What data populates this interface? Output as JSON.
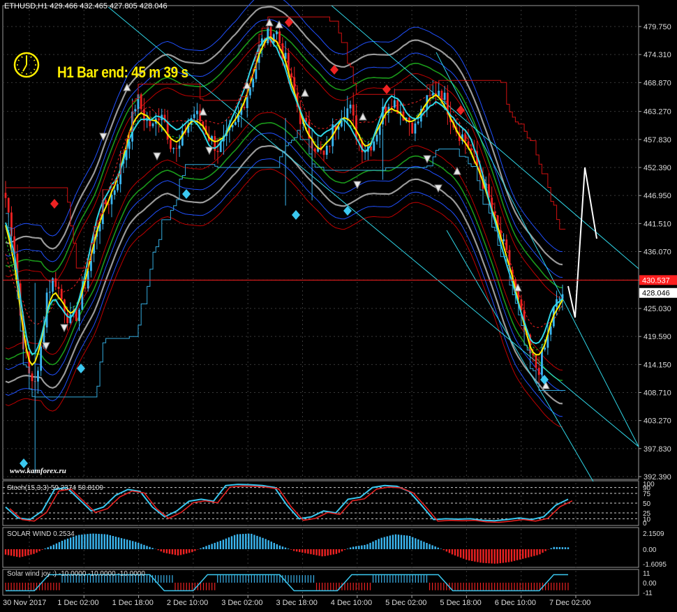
{
  "header": {
    "text": "ETHUSD,H1  429.466 432.465 427.805 428.046"
  },
  "timer": {
    "label": "H1 Bar end: 45 m 39 s"
  },
  "watermark": "www.kamforex.ru",
  "price_axis": {
    "ticks": [
      "479.750",
      "474.310",
      "468.870",
      "463.270",
      "457.830",
      "452.390",
      "446.950",
      "441.510",
      "436.070",
      "430.537",
      "425.030",
      "419.590",
      "414.150",
      "408.710",
      "403.270",
      "397.830",
      "392.390"
    ],
    "current_price": "428.046",
    "ask_line": "430.537"
  },
  "time_axis": {
    "labels": [
      "30 Nov 2017",
      "1 Dec 02:00",
      "1 Dec 18:00",
      "2 Dec 10:00",
      "3 Dec 02:00",
      "3 Dec 18:00",
      "4 Dec 10:00",
      "5 Dec 02:00",
      "5 Dec 18:00",
      "6 Dec 10:00",
      "7 Dec 02:00"
    ]
  },
  "subwindows": {
    "stoch": {
      "label": "Stoch(15,3,3) 59.2374 50.8109",
      "levels": [
        "100",
        "90",
        "75",
        "50",
        "25",
        "10",
        "0"
      ]
    },
    "solar_wind": {
      "label": "SOLAR WIND 0.2534",
      "levels": [
        "2.1509",
        "0.00",
        "-1.6095"
      ]
    },
    "solar_wind_joy": {
      "label": "Solar wind joy :) -10.0000 -10.0000 -10.0000",
      "levels": [
        "11",
        "0.00",
        "-11"
      ]
    }
  },
  "colors": {
    "background": "#000000",
    "grid": "#3a3a3a",
    "bull": "#3bb6f0",
    "bear": "#ee2222",
    "yellow_line": "#ffee00",
    "cyan": "#2fd7e8",
    "ask": "#ff2020"
  },
  "chart_data": {
    "type": "candlestick",
    "symbol": "ETHUSD",
    "timeframe": "H1",
    "ylim": [
      392.39,
      479.75
    ],
    "last_bar": {
      "open": 429.466,
      "high": 432.465,
      "low": 427.805,
      "close": 428.046
    },
    "close_path": [
      446.5,
      438,
      420,
      411,
      412,
      428,
      431,
      426,
      422,
      425,
      432,
      440,
      445,
      447,
      452,
      458,
      466,
      462,
      460,
      464,
      458,
      455,
      460,
      463,
      461,
      458,
      456,
      458,
      460,
      465,
      469,
      476,
      478,
      479,
      474,
      468,
      462,
      459,
      456,
      454,
      460,
      463,
      464,
      458,
      456,
      458,
      463,
      466,
      464,
      462,
      460,
      464,
      466,
      468,
      464,
      460,
      458,
      455,
      451,
      446,
      440,
      436,
      430,
      423,
      416,
      413,
      418,
      425,
      428
    ],
    "stoch_close_path": [
      40,
      12,
      8,
      30,
      85,
      90,
      60,
      30,
      40,
      70,
      85,
      80,
      40,
      15,
      30,
      55,
      60,
      55,
      95,
      98,
      97,
      95,
      90,
      45,
      10,
      15,
      30,
      25,
      60,
      65,
      90,
      95,
      93,
      80,
      45,
      8,
      10,
      9,
      10,
      6,
      5,
      8,
      12,
      8,
      15,
      45,
      60
    ],
    "solar_wind": [
      -0.6,
      -0.9,
      -0.5,
      0.3,
      1.2,
      1.9,
      2.1,
      2.0,
      1.5,
      1.0,
      0.3,
      -0.4,
      -0.7,
      -0.3,
      0.5,
      1.2,
      2.0,
      2.1,
      1.4,
      0.5,
      -0.2,
      -0.5,
      -0.8,
      -0.5,
      0.3,
      0.6,
      1.5,
      2.0,
      1.8,
      1.0,
      0.2,
      -0.6,
      -1.2,
      -1.5,
      -1.6,
      -1.4,
      -1.0,
      -0.6,
      0.3,
      0.25
    ],
    "solar_wind_joy": [
      -10,
      -10,
      -10,
      -10,
      10,
      10,
      10,
      10,
      10,
      10,
      10,
      10,
      -10,
      -10,
      -10,
      10,
      10,
      10,
      10,
      10,
      10,
      10,
      -10,
      -10,
      -10,
      -10,
      10,
      10,
      10,
      10,
      -10,
      -10,
      -10,
      -10,
      -10,
      -10,
      -10,
      -10,
      -10,
      -10
    ]
  }
}
